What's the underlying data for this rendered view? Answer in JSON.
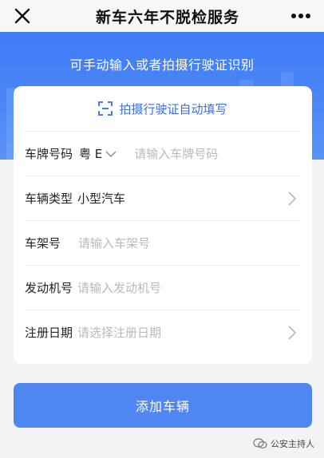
{
  "nav": {
    "title": "新车六年不脱检服务",
    "close_icon": "close-icon",
    "more_icon": "more-dots-icon"
  },
  "banner": {
    "hint": "可手动输入或者拍摄行驶证识别"
  },
  "form": {
    "auto_fill_label": "拍摄行驶证自动填写",
    "plate": {
      "label": "车牌号码",
      "province": "粤 E",
      "placeholder": "请输入车牌号码"
    },
    "vehicle_type": {
      "label": "车辆类型",
      "value": "小型汽车"
    },
    "frame_number": {
      "label": "车架号",
      "placeholder": "请输入车架号"
    },
    "engine_number": {
      "label": "发动机号",
      "placeholder": "请输入发动机号"
    },
    "register_date": {
      "label": "注册日期",
      "placeholder": "请选择注册日期"
    }
  },
  "actions": {
    "add_vehicle": "添加车辆"
  },
  "watermark": {
    "text": "公安主持人"
  },
  "colors": {
    "primary": "#4f86f2",
    "banner": "#3f7bf5",
    "link": "#3a6fd8",
    "placeholder": "#b9b9b9"
  }
}
